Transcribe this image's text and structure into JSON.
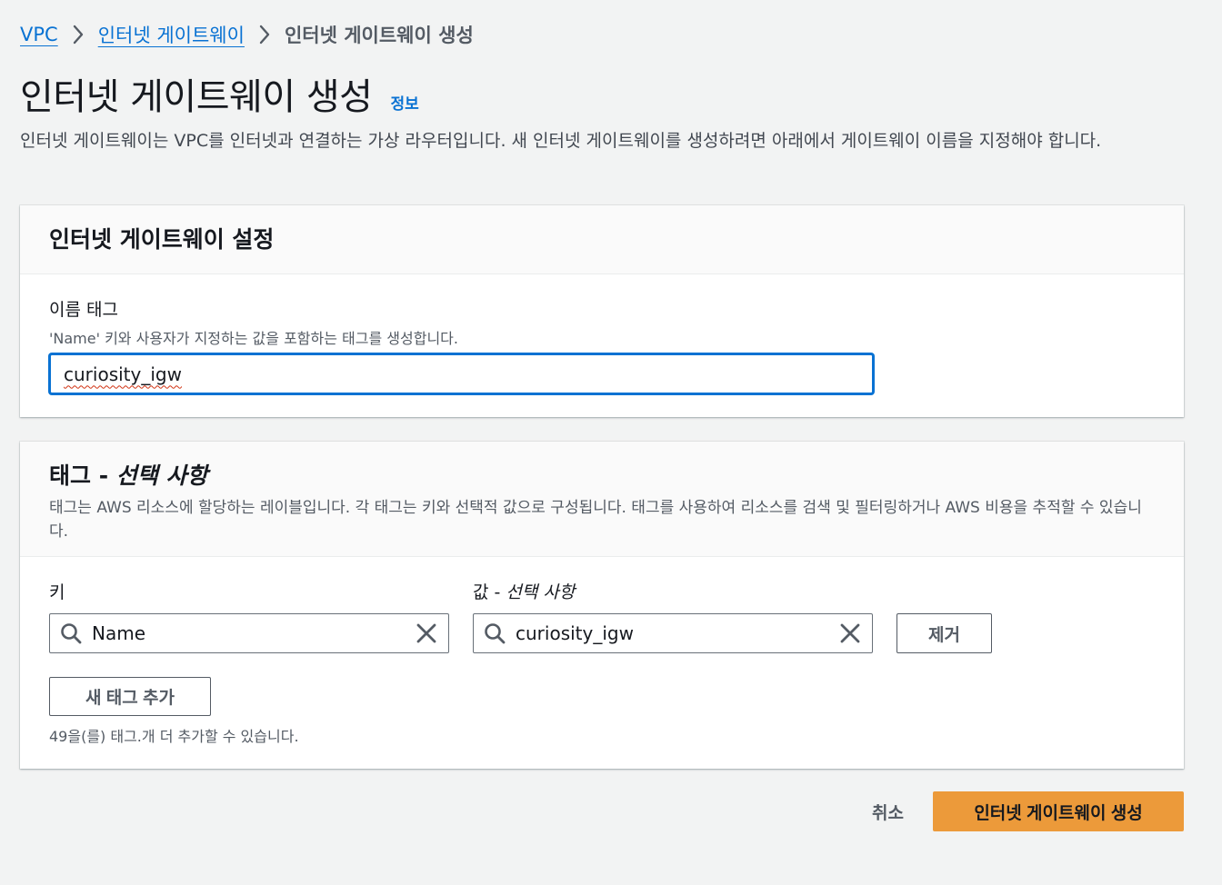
{
  "breadcrumb": {
    "items": [
      {
        "label": "VPC"
      },
      {
        "label": "인터넷 게이트웨이"
      },
      {
        "label": "인터넷 게이트웨이 생성"
      }
    ]
  },
  "header": {
    "title": "인터넷 게이트웨이 생성",
    "info_link": "정보",
    "description": "인터넷 게이트웨이는 VPC를 인터넷과 연결하는 가상 라우터입니다. 새 인터넷 게이트웨이를 생성하려면 아래에서 게이트웨이 이름을 지정해야 합니다."
  },
  "settings_panel": {
    "title": "인터넷 게이트웨이 설정",
    "name_tag_label": "이름 태그",
    "name_tag_description": "'Name' 키와 사용자가 지정하는 값을 포함하는 태그를 생성합니다.",
    "name_tag_value": "curiosity_igw"
  },
  "tags_panel": {
    "title_prefix": "태그 - ",
    "title_optional": "선택 사항",
    "description": "태그는 AWS 리소스에 할당하는 레이블입니다. 각 태그는 키와 선택적 값으로 구성됩니다. 태그를 사용하여 리소스를 검색 및 필터링하거나 AWS 비용을 추적할 수 있습니다.",
    "key_label": "키",
    "value_label_prefix": "값 - ",
    "value_label_optional": "선택 사항",
    "tag_key": "Name",
    "tag_value": "curiosity_igw",
    "remove_button": "제거",
    "add_tag_button": "새 태그 추가",
    "remaining_hint": "49을(를) 태그.개 더 추가할 수 있습니다."
  },
  "footer": {
    "cancel_label": "취소",
    "submit_label": "인터넷 게이트웨이 생성"
  },
  "colors": {
    "link": "#0972d3",
    "primary_button": "#ec9a3a",
    "background": "#f2f3f3"
  },
  "icons": {
    "breadcrumb_separator": "chevron-right-icon",
    "search": "search-icon",
    "clear": "close-icon"
  }
}
